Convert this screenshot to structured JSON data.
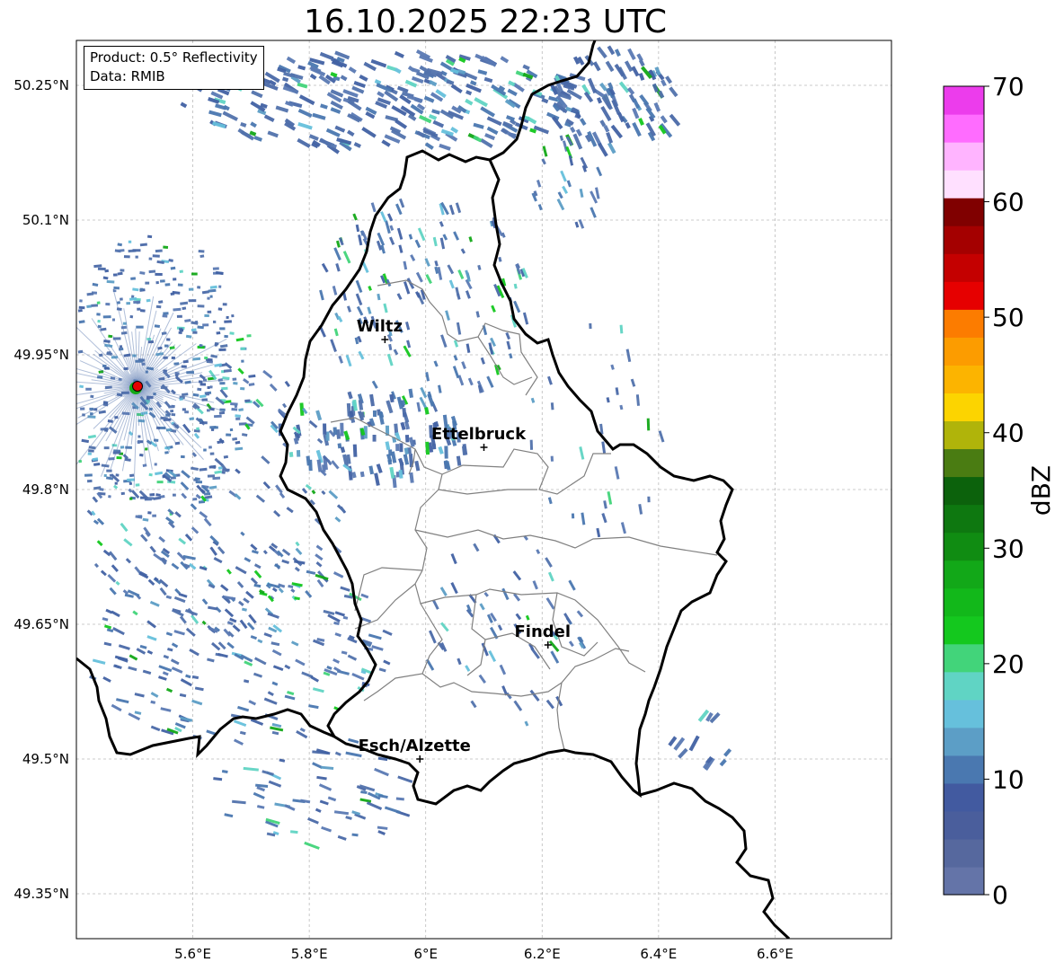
{
  "title": "16.10.2025 22:23 UTC",
  "info_box": {
    "product": "Product: 0.5° Reflectivity",
    "data_source": "Data: RMIB"
  },
  "map": {
    "lon_range": [
      5.4,
      6.8
    ],
    "lat_range": [
      49.3,
      50.3
    ],
    "lon_ticks": [
      {
        "value": 5.6,
        "label": "5.6°E"
      },
      {
        "value": 5.8,
        "label": "5.8°E"
      },
      {
        "value": 6.0,
        "label": "6°E"
      },
      {
        "value": 6.2,
        "label": "6.2°E"
      },
      {
        "value": 6.4,
        "label": "6.4°E"
      },
      {
        "value": 6.6,
        "label": "6.6°E"
      }
    ],
    "lat_ticks": [
      {
        "value": 50.25,
        "label": "50.25°N"
      },
      {
        "value": 50.1,
        "label": "50.1°N"
      },
      {
        "value": 49.95,
        "label": "49.95°N"
      },
      {
        "value": 49.8,
        "label": "49.8°N"
      },
      {
        "value": 49.65,
        "label": "49.65°N"
      },
      {
        "value": 49.5,
        "label": "49.5°N"
      },
      {
        "value": 49.35,
        "label": "49.35°N"
      }
    ],
    "cities": [
      {
        "name": "Wiltz",
        "lon": 5.93,
        "lat": 49.967
      },
      {
        "name": "Ettelbruck",
        "lon": 6.1,
        "lat": 49.847
      },
      {
        "name": "Findel",
        "lon": 6.21,
        "lat": 49.627
      },
      {
        "name": "Esch/Alzette",
        "lon": 5.99,
        "lat": 49.5
      }
    ],
    "radar_site": {
      "lon": 5.505,
      "lat": 49.915
    },
    "grid": true
  },
  "colorbar": {
    "label": "dBZ",
    "min": 0,
    "max": 70,
    "ticks": [
      {
        "value": 0,
        "label": "0"
      },
      {
        "value": 10,
        "label": "10"
      },
      {
        "value": 20,
        "label": "20"
      },
      {
        "value": 30,
        "label": "30"
      },
      {
        "value": 40,
        "label": "40"
      },
      {
        "value": 50,
        "label": "50"
      },
      {
        "value": 60,
        "label": "60"
      },
      {
        "value": 70,
        "label": "70"
      }
    ],
    "colors": [
      "#6474a8",
      "#56689e",
      "#4a5e9c",
      "#425aa0",
      "#4a78b0",
      "#5c9ec6",
      "#66c0dc",
      "#60d4c4",
      "#42d47a",
      "#14c81e",
      "#12b81a",
      "#12a818",
      "#108c12",
      "#0e7810",
      "#0c620c",
      "#4a7c12",
      "#b0b40a",
      "#fcd400",
      "#fcb400",
      "#fc9c00",
      "#fc7c00",
      "#e60000",
      "#c40000",
      "#a40000",
      "#800000",
      "#ffe0ff",
      "#ffb4ff",
      "#ff6cff",
      "#ec3cec"
    ]
  }
}
